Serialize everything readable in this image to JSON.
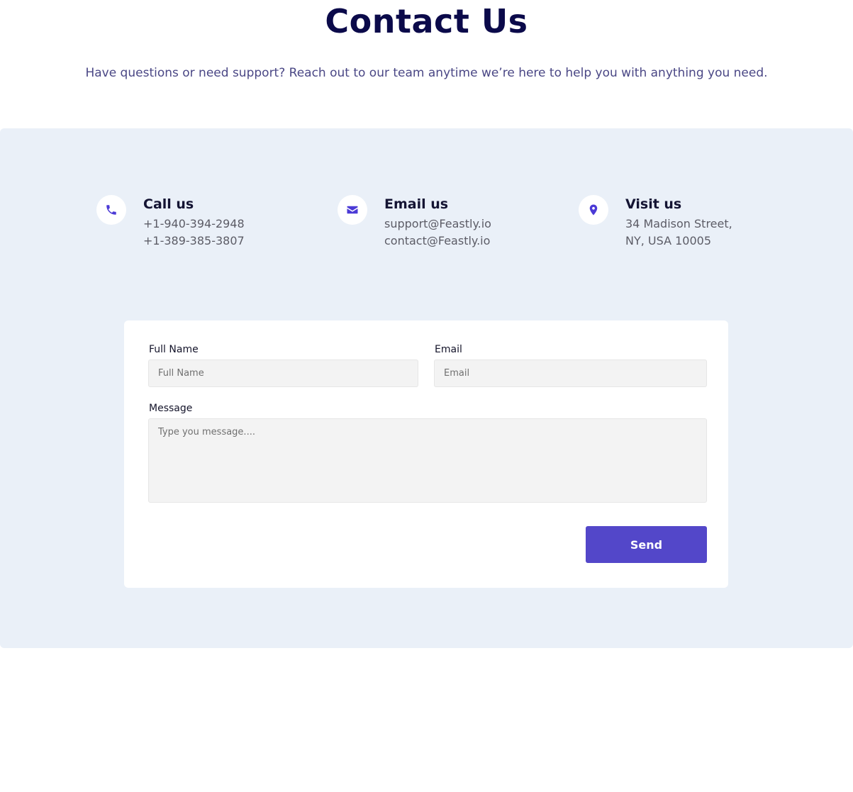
{
  "header": {
    "title": "Contact Us",
    "subtitle": "Have questions or need support? Reach out to our team anytime we’re here to help you with anything you need."
  },
  "contact_info": [
    {
      "icon": "phone-icon",
      "heading": "Call us",
      "lines": [
        "+1-940-394-2948",
        "+1-389-385-3807"
      ]
    },
    {
      "icon": "envelope-icon",
      "heading": "Email us",
      "lines": [
        "support@Feastly.io",
        "contact@Feastly.io"
      ]
    },
    {
      "icon": "map-pin-icon",
      "heading": "Visit us",
      "lines": [
        "34 Madison Street,",
        "NY, USA 10005"
      ]
    }
  ],
  "form": {
    "full_name": {
      "label": "Full Name",
      "placeholder": "Full Name",
      "value": ""
    },
    "email": {
      "label": "Email",
      "placeholder": "Email",
      "value": ""
    },
    "message": {
      "label": "Message",
      "placeholder": "Type you message....",
      "value": ""
    },
    "send_label": "Send"
  },
  "colors": {
    "accent": "#5347c9",
    "title": "#0b0a4a",
    "panel_background": "#eaf0f8"
  }
}
